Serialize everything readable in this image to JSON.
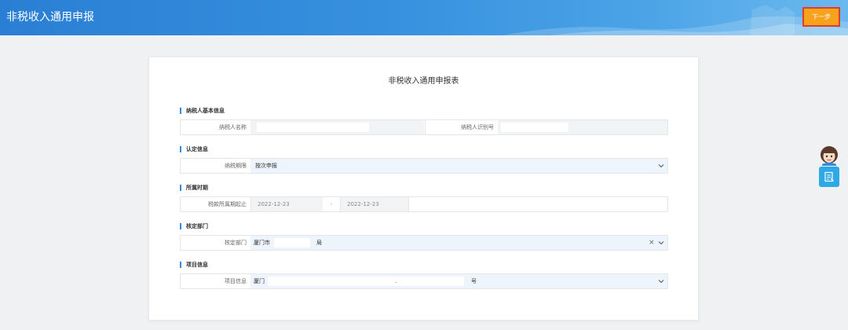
{
  "header": {
    "title": "非税收入通用申报",
    "next_label": "下一步"
  },
  "form": {
    "title": "非税收入通用申报表"
  },
  "sections": {
    "taxpayer": {
      "title": "纳税人基本信息",
      "name_label": "纳税人名称",
      "name_value": "",
      "id_label": "纳税人识别号",
      "id_value": ""
    },
    "recognition": {
      "title": "认定信息",
      "period_label": "纳税期限",
      "period_value": "按次申报"
    },
    "period": {
      "title": "所属时期",
      "label": "税款所属期起止",
      "start": "2022-12-23",
      "sep": "-",
      "end": "2022-12-23"
    },
    "department": {
      "title": "核定部门",
      "label": "核定部门",
      "value_prefix": "厦门市",
      "value_suffix": "局",
      "clear_symbol": "×"
    },
    "project": {
      "title": "项目信息",
      "label": "项目信息",
      "value_prefix": "厦门",
      "value_mid": ".",
      "value_suffix": "号"
    }
  },
  "icons": {
    "avatar": "customer-service-avatar-icon",
    "side": "document-icon",
    "chevron": "chevron-down-icon"
  },
  "colors": {
    "header": "#2a7fd4",
    "next_button": "#f6a21d",
    "accent": "#2f8ce0",
    "side_button": "#2fa8e6"
  }
}
